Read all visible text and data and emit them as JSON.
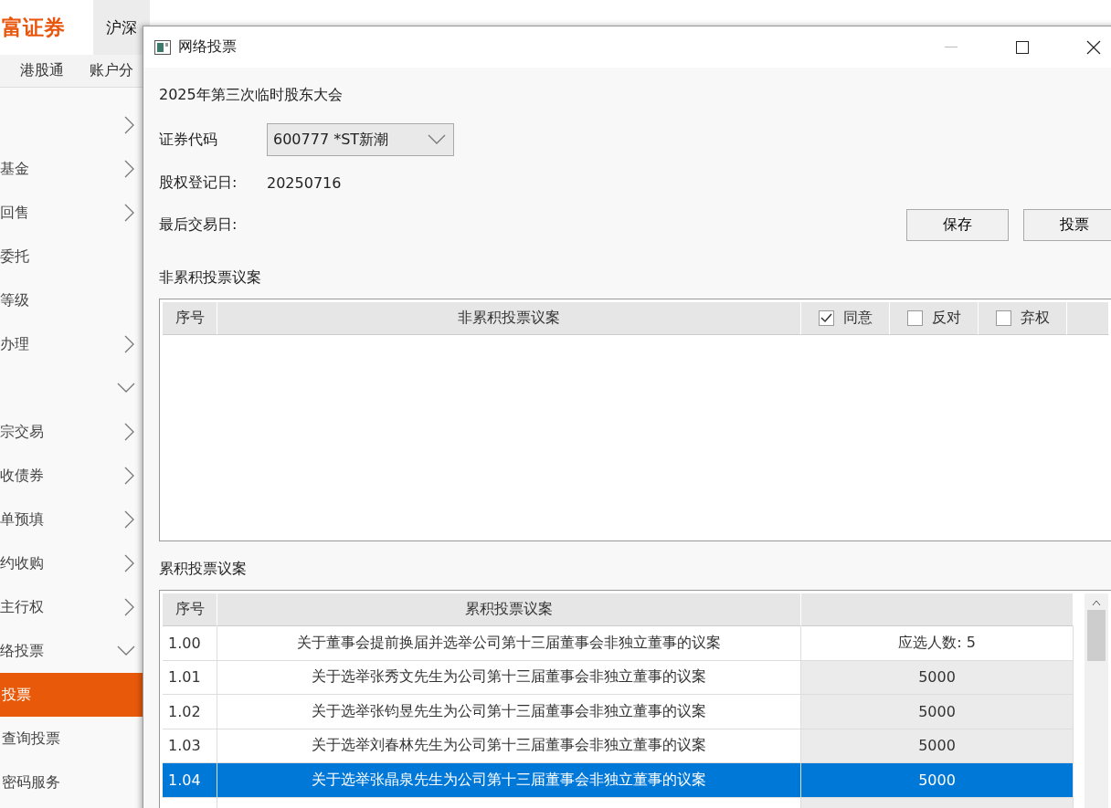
{
  "app": {
    "logo": "富证券",
    "nav": [
      {
        "label": "沪深",
        "selected": true
      }
    ],
    "subnav": [
      "港股通",
      "账户分"
    ]
  },
  "sidebar": {
    "items": [
      {
        "expanded": false
      },
      {
        "label": "基金",
        "expanded": false
      },
      {
        "label": "回售",
        "expanded": false
      },
      {
        "label": "委托",
        "kind": "leaf"
      },
      {
        "label": "等级",
        "kind": "leaf"
      },
      {
        "label": "办理",
        "expanded": false
      },
      {
        "expanded": true
      },
      {
        "label": "宗交易",
        "expanded": false
      },
      {
        "label": "收债券",
        "expanded": false
      },
      {
        "label": "单预填",
        "expanded": false
      },
      {
        "label": "约收购",
        "expanded": false
      },
      {
        "label": "主行权",
        "expanded": false
      },
      {
        "label": "络投票",
        "expanded": true,
        "children": [
          {
            "label": "投票",
            "selected": true
          },
          {
            "label": "查询投票",
            "selected": false
          },
          {
            "label": "密码服务",
            "selected": false
          }
        ]
      }
    ]
  },
  "dialog": {
    "title": "网络投票",
    "meeting": "2025年第三次临时股东大会",
    "code_label": "证券代码",
    "code_value": "600777 *ST新潮",
    "reg_label": "股权登记日:",
    "reg_value": "20250716",
    "last_label": "最后交易日:",
    "actions": [
      "保存",
      "投票"
    ],
    "noncumulative": {
      "title": "非累积投票议案",
      "columns": [
        "序号",
        "非累积投票议案"
      ],
      "options": [
        {
          "label": "同意",
          "checked": true
        },
        {
          "label": "反对",
          "checked": false
        },
        {
          "label": "弃权",
          "checked": false
        }
      ]
    },
    "cumulative": {
      "title": "累积投票议案",
      "columns": [
        "序号",
        "累积投票议案"
      ],
      "rows": [
        {
          "no": "1.00",
          "motion": "关于董事会提前换届并选举公司第十三届董事会非独立董事的议案",
          "value": "应选人数: 5",
          "kind": "group",
          "selected": false
        },
        {
          "no": "1.01",
          "motion": "关于选举张秀文先生为公司第十三届董事会非独立董事的议案",
          "value": "5000",
          "kind": "input",
          "selected": false
        },
        {
          "no": "1.02",
          "motion": "关于选举张钧昱先生为公司第十三届董事会非独立董事的议案",
          "value": "5000",
          "kind": "input",
          "selected": false
        },
        {
          "no": "1.03",
          "motion": "关于选举刘春林先生为公司第十三届董事会非独立董事的议案",
          "value": "5000",
          "kind": "input",
          "selected": false
        },
        {
          "no": "1.04",
          "motion": "关于选举张晶泉先生为公司第十三届董事会非独立董事的议案",
          "value": "5000",
          "kind": "input",
          "selected": true
        }
      ]
    }
  }
}
